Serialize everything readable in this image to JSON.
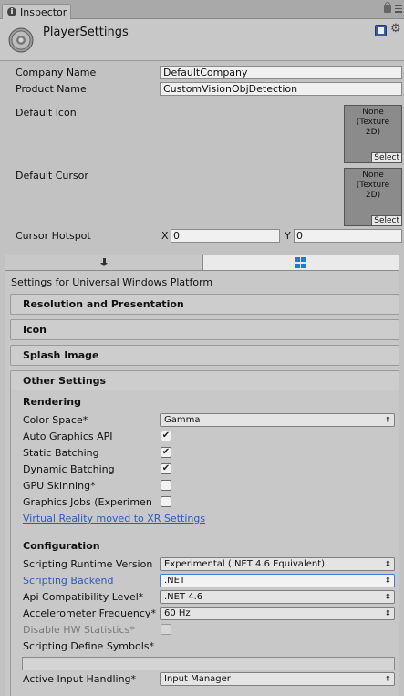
{
  "tab": {
    "label": "Inspector"
  },
  "header": {
    "title": "PlayerSettings"
  },
  "fields": {
    "company_name_label": "Company Name",
    "company_name_value": "DefaultCompany",
    "product_name_label": "Product Name",
    "product_name_value": "CustomVisionObjDetection",
    "default_icon_label": "Default Icon",
    "default_cursor_label": "Default Cursor",
    "texture_none": "None",
    "texture_type": "(Texture",
    "texture_dim": "2D)",
    "texture_select": "Select",
    "cursor_hotspot_label": "Cursor Hotspot",
    "x_label": "X",
    "x_value": "0",
    "y_label": "Y",
    "y_value": "0"
  },
  "platform": {
    "settings_for": "Settings for Universal Windows Platform"
  },
  "foldouts": {
    "resolution": "Resolution and Presentation",
    "icon": "Icon",
    "splash": "Splash Image",
    "other": "Other Settings"
  },
  "rendering": {
    "heading": "Rendering",
    "color_space_label": "Color Space*",
    "color_space_value": "Gamma",
    "auto_graphics_label": "Auto Graphics API",
    "static_batching_label": "Static Batching",
    "dynamic_batching_label": "Dynamic Batching",
    "gpu_skinning_label": "GPU Skinning*",
    "graphics_jobs_label": "Graphics Jobs (Experimen",
    "vr_link": "Virtual Reality moved to XR Settings",
    "check_mark": "✔"
  },
  "configuration": {
    "heading": "Configuration",
    "runtime_label": "Scripting Runtime Version",
    "runtime_value": "Experimental (.NET 4.6 Equivalent)",
    "backend_label": "Scripting Backend",
    "backend_value": ".NET",
    "api_label": "Api Compatibility Level*",
    "api_value": ".NET 4.6",
    "accel_label": "Accelerometer Frequency*",
    "accel_value": "60 Hz",
    "hw_stats_label": "Disable HW Statistics*",
    "define_symbols_label": "Scripting Define Symbols*",
    "input_label": "Active Input Handling*",
    "input_value": "Input Manager"
  },
  "dropdown_arrow": "⬍"
}
